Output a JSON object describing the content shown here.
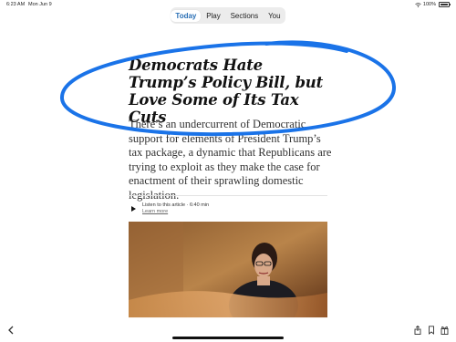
{
  "status": {
    "time": "6:23 AM",
    "date": "Mon Jun 9",
    "battery": "100%"
  },
  "tabs": [
    {
      "label": "Today"
    },
    {
      "label": "Play"
    },
    {
      "label": "Sections"
    },
    {
      "label": "You"
    }
  ],
  "article": {
    "headline": "Democrats Hate Trump’s Policy Bill, but Love Some of Its Tax Cuts",
    "summary": "There’s an undercurrent of Democratic support for elements of President Trump’s tax package, a dynamic that Republicans are trying to exploit as they make the case for enactment of their sprawling domestic legislation.",
    "audio": {
      "title": "Listen to this article · 6:40 min",
      "link": "Learn more"
    }
  },
  "colors": {
    "accent": "#2a6fb5",
    "annotation": "#1a73e8"
  },
  "icons": [
    "back-icon",
    "share-icon",
    "bookmark-icon",
    "gift-icon",
    "play-icon",
    "wifi-icon",
    "battery-icon"
  ]
}
